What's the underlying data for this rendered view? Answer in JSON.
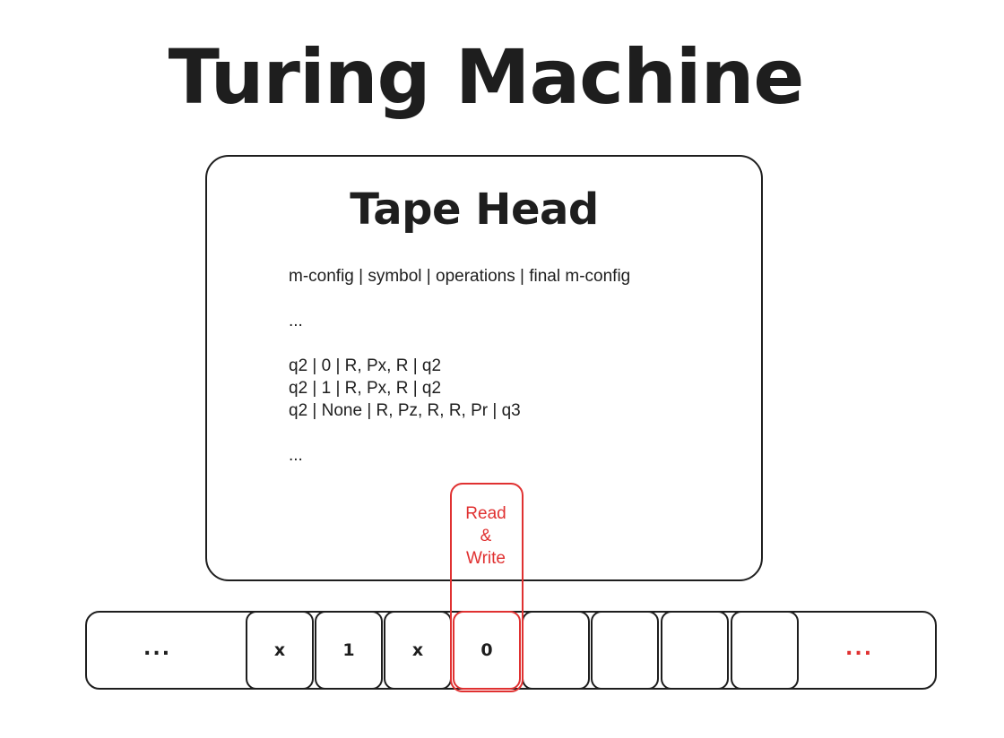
{
  "title": "Turing Machine",
  "tape_head": {
    "title": "Tape Head",
    "rules": [
      "m-config | symbol | operations | final m-config",
      "",
      "...",
      "",
      "q2 | 0 | R, Px, R | q2",
      "q2 | 1 | R, Px, R | q2",
      "q2 | None | R, Pz, R, R, Pr | q3",
      "",
      "..."
    ]
  },
  "read_write": {
    "lines": [
      "Read",
      "&",
      "Write"
    ]
  },
  "tape": {
    "left_ellipsis": "...",
    "right_ellipsis": "...",
    "cells": [
      "x",
      "1",
      "x",
      "0",
      "",
      "",
      "",
      ""
    ],
    "active_index": 3
  },
  "colors": {
    "ink": "#1e1e1e",
    "accent": "#e03131"
  }
}
